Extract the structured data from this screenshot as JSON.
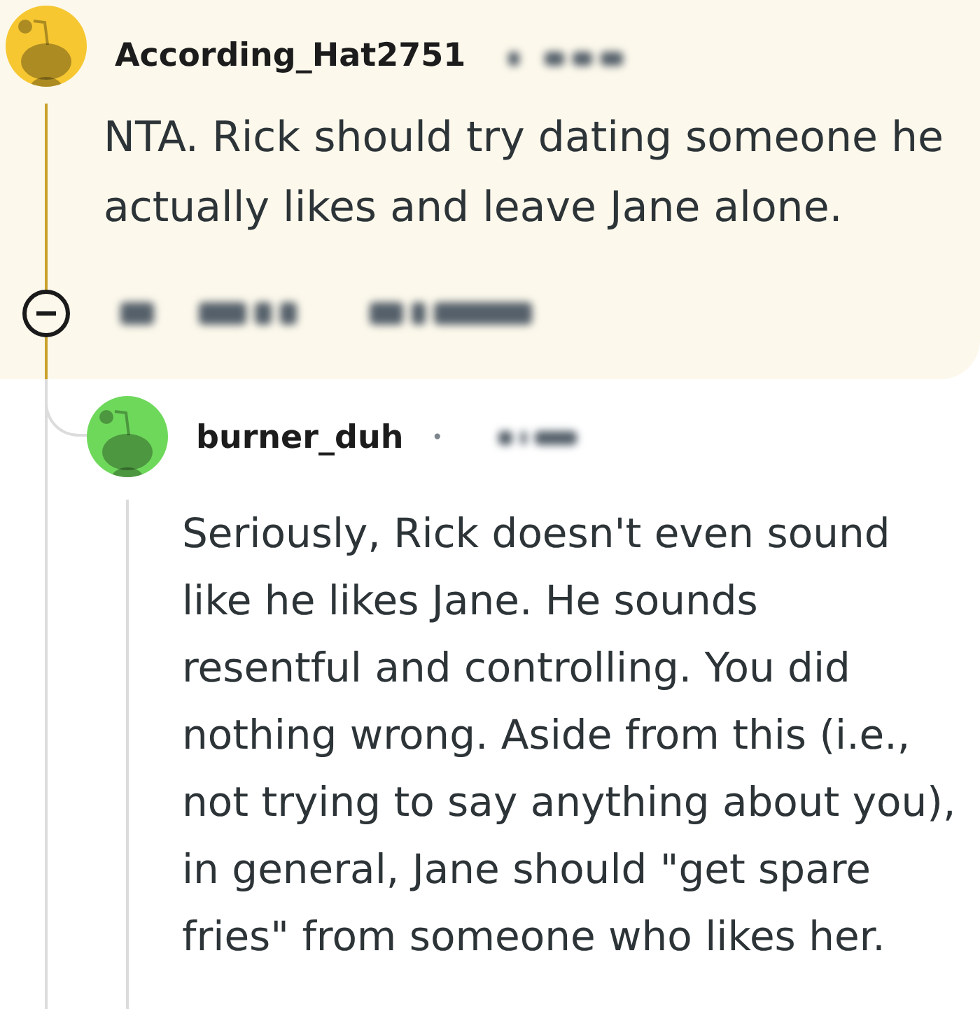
{
  "comment": {
    "username": "According_Hat2751",
    "color": "#f6c731",
    "highlighted": true,
    "expanded": true,
    "body": "NTA. Rick should try dating someone he actually likes and leave Jane alone.",
    "replies": [
      {
        "username": "burner_duh",
        "color": "#6ed85b",
        "separator": "•",
        "body": "Seriously, Rick doesn't even sound\nlike he likes Jane. He sounds\nresentful and controlling. You did\nnothing wrong. Aside from this (i.e.,\nnot trying to say anything about you),\nin general, Jane should \"get spare\nfries\" from someone who likes her."
      }
    ]
  }
}
